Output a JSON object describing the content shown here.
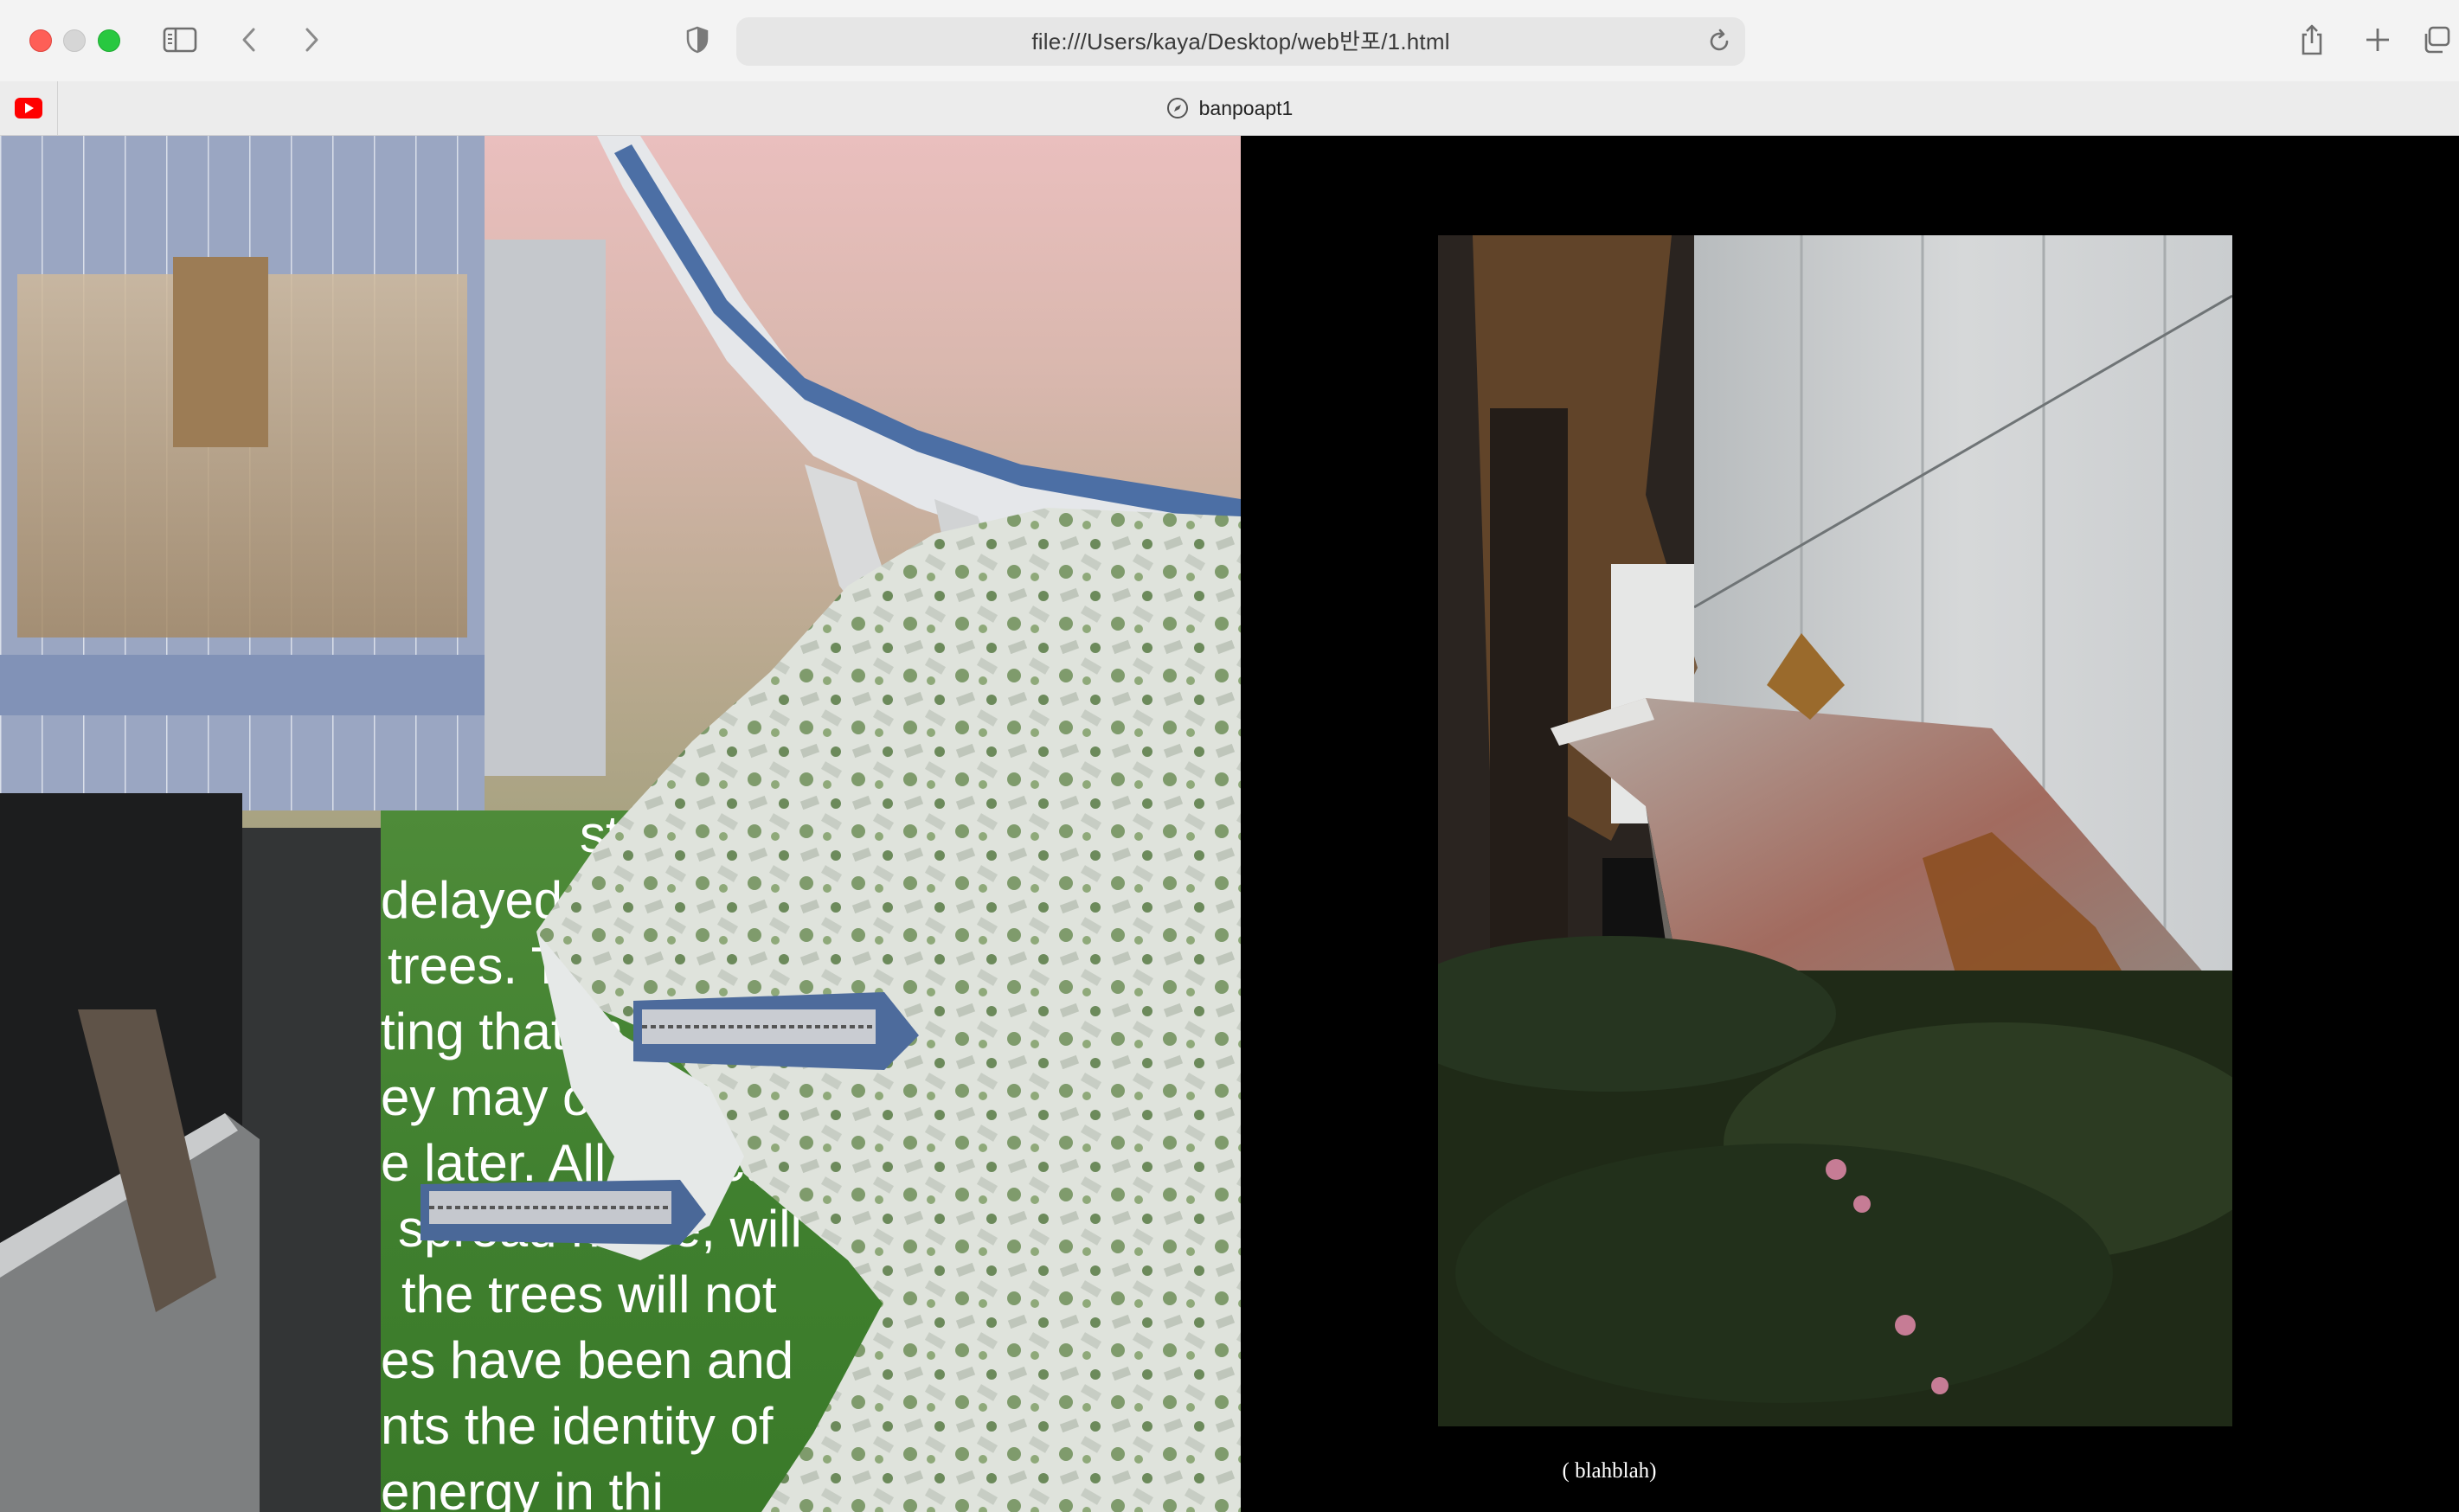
{
  "browser": {
    "url": "file:///Users/kaya/Desktop/web반포/1.html",
    "tab_title": "banpoapt1",
    "icons": {
      "close": "close-dot",
      "minimize": "minimize-dot",
      "zoom": "zoom-dot",
      "sidebar": "sidebar-icon",
      "back": "chevron-left-icon",
      "forward": "chevron-right-icon",
      "privacy": "shield-icon",
      "reload": "reload-icon",
      "share": "share-icon",
      "new_tab": "plus-icon",
      "tab_overview": "tab-overview-icon",
      "pinned_tab": "youtube-icon",
      "tab_favicon": "compass-icon"
    },
    "colors": {
      "close": "#fe5f57",
      "minimize": "#d6d6d6",
      "zoom": "#28c840"
    }
  },
  "page": {
    "background": "#000000",
    "collage_text_lines": [
      "struction",
      "delayed u",
      "trees. The",
      "ting that th",
      "ey may or  no",
      "e later. All objects",
      "spread home, will",
      "the trees will not",
      "es have been and",
      "nts the identity of",
      "energy in thi"
    ],
    "photo_caption": "( blahblah)"
  }
}
